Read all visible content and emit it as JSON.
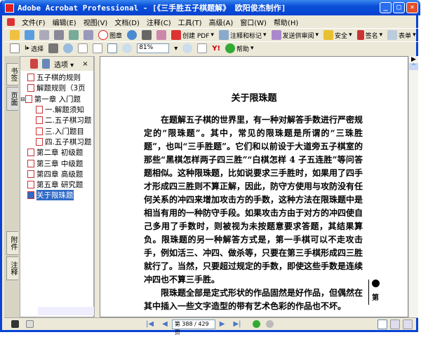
{
  "window": {
    "title": "Adobe Acrobat Professional - [《三手胜五子棋题解》  欧阳俊杰制作]"
  },
  "menu": [
    "文件(F)",
    "编辑(E)",
    "视图(V)",
    "文档(D)",
    "注释(C)",
    "工具(T)",
    "高级(A)",
    "窗口(W)",
    "帮助(H)"
  ],
  "toolbar1": {
    "stamp": "图章",
    "create_pdf": "创建 PDF",
    "comment": "注释和标记",
    "review": "发送供审阅",
    "secure": "安全",
    "sign": "签名",
    "forms": "表单"
  },
  "toolbar2": {
    "select": "选择",
    "zoom": "81%",
    "help": "帮助"
  },
  "side_tabs": [
    "书签",
    "页面",
    "附件",
    "注释"
  ],
  "panel": {
    "options": "选项",
    "close": "×",
    "bookmarks": [
      {
        "label": "五子棋的规则",
        "level": 0
      },
      {
        "label": "解题规则（3页",
        "level": 0
      },
      {
        "label": "第一章 入门题",
        "level": 0,
        "expanded": true
      },
      {
        "label": "一.解题须知",
        "level": 1
      },
      {
        "label": "二.五子棋习题",
        "level": 1
      },
      {
        "label": "三.入门题目",
        "level": 1
      },
      {
        "label": "四.五子棋习题",
        "level": 1
      },
      {
        "label": "第二章 初级题",
        "level": 0
      },
      {
        "label": "第三章 中级题",
        "level": 0
      },
      {
        "label": "第四章 高级题",
        "level": 0
      },
      {
        "label": "第五章 研究题",
        "level": 0
      },
      {
        "label": "关于限珠题",
        "level": 0,
        "selected": true
      }
    ]
  },
  "document": {
    "heading": "关于限珠题",
    "paragraphs": [
      "在题解五子棋的世界里，有一种对解答手数进行严密规定的“限珠题”。其中，常见的限珠题是所谓的“三珠胜题”，也叫“三手胜题”。它们和以前设于大道旁五子棋室的那些“黑棋怎样两子四三胜”“白棋怎样 4 子五连胜”等问答题相似。这种限珠题，比如说要求三手胜时，如果用了四手才形成四三胜则不算正解，因此，防守方使用与攻防没有任何关系的冲四来增加攻击方的手数，这种方法在限珠题中是相当有用的一种防守手段。如果攻击方由于对方的冲四使自己多用了手数时，则被视为未按题意要求答题，其结果算负。限珠题的另一种解答方式是，第一手棋可以不走攻击手，例如活三、冲四、做杀等，只要在第三手棋形成四三胜就行了。当然，只要超过规定的手数，即使这些手数是连续冲四也不算三手胜。",
      "限珠题全部是定式形状的作品固然是好作品，但偶然在其中插入一些文字造型的带有艺术色彩的作品也不坏。"
    ],
    "margin_note": "第"
  },
  "status": {
    "page": "第 388 / 429 页"
  },
  "colors": {
    "titlebar": "#0a4fd8",
    "selection": "#316ac5"
  }
}
